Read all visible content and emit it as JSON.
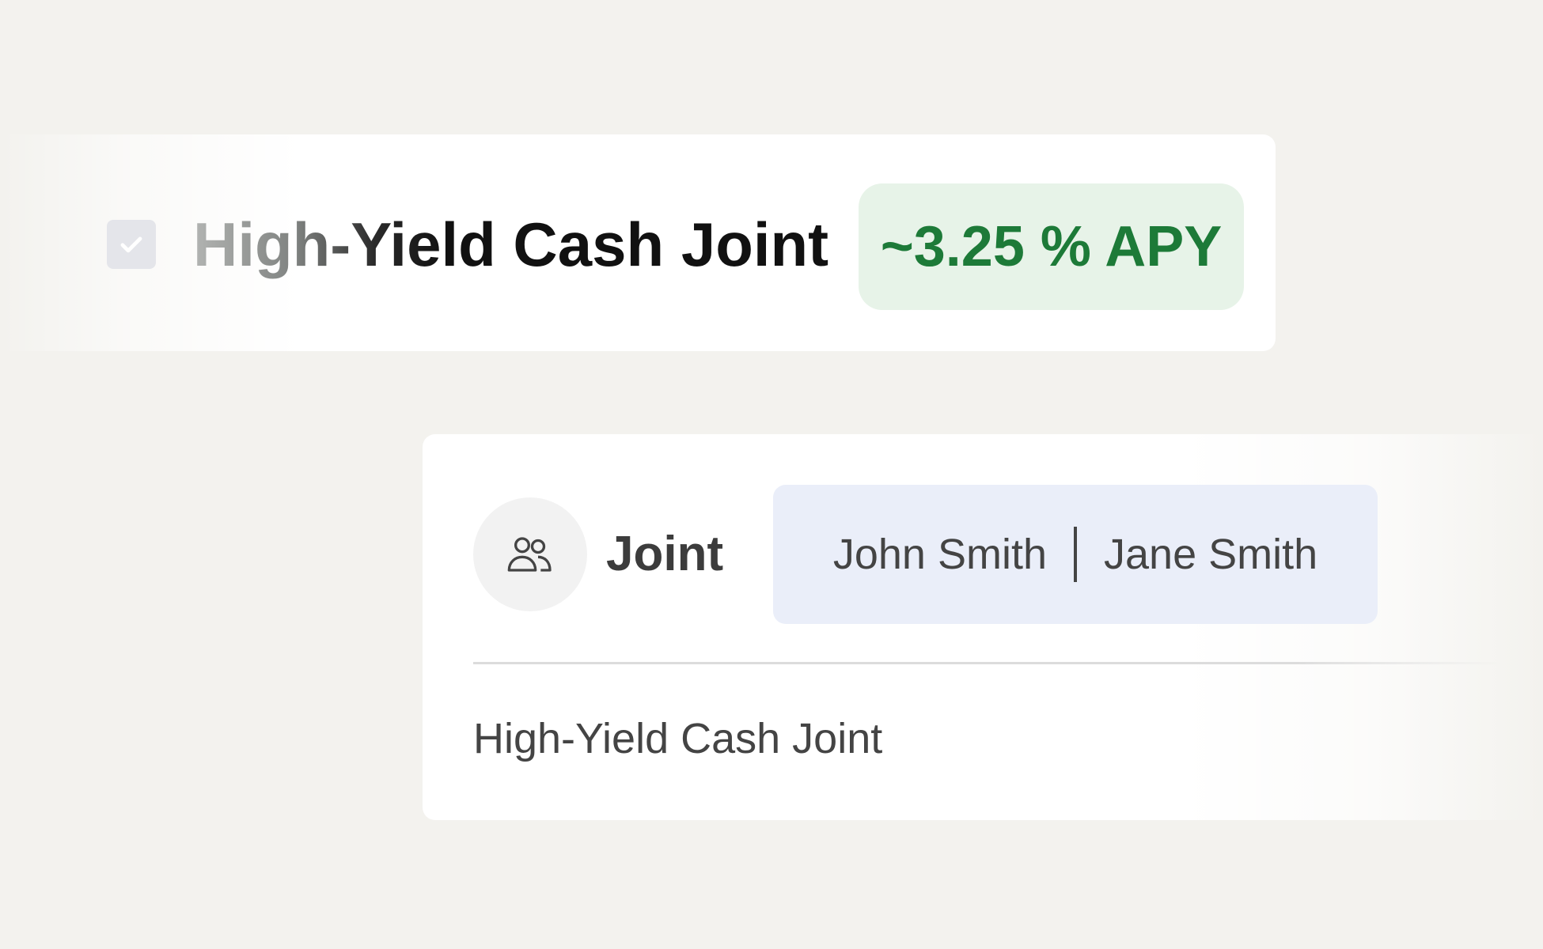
{
  "top_card": {
    "title": "High-Yield Cash Joint",
    "apy_badge": "~3.25 % APY",
    "checked": true,
    "checkbox_icon": "check-icon",
    "badge_color": "#1d7a38"
  },
  "bottom_card": {
    "account_type_icon": "users-icon",
    "account_type": "Joint",
    "owners": [
      "John Smith",
      "Jane Smith"
    ],
    "account_name": "High-Yield Cash Joint"
  }
}
